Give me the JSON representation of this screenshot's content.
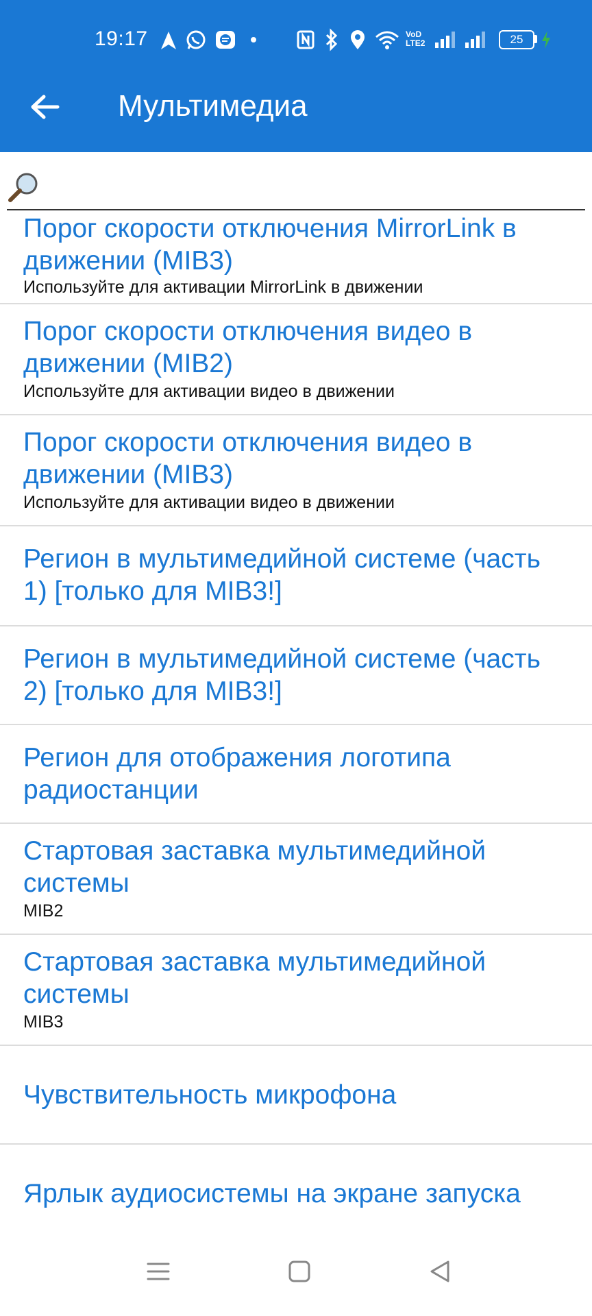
{
  "status_bar": {
    "time": "19:17",
    "battery": "25",
    "network_label_top": "VoD",
    "network_label_bottom": "LTE2"
  },
  "app_bar": {
    "title": "Мультимедиа",
    "background_color": "#1a78d4"
  },
  "search": {
    "value": "",
    "placeholder": ""
  },
  "list": {
    "items": [
      {
        "title": "Порог скорости отключения MirrorLink в движении (MIB3)",
        "subtitle": "Используйте для активации MirrorLink в движении"
      },
      {
        "title": "Порог скорости отключения видео в движении (MIB2)",
        "subtitle": "Используйте для активации видео в движении"
      },
      {
        "title": "Порог скорости отключения видео в движении (MIB3)",
        "subtitle": "Используйте для активации видео в движении"
      },
      {
        "title": "Регион в мультимедийной системе (часть 1) [только для MIB3!]",
        "subtitle": ""
      },
      {
        "title": "Регион в мультимедийной системе (часть 2) [только для MIB3!]",
        "subtitle": ""
      },
      {
        "title": "Регион для отображения логотипа радиостанции",
        "subtitle": ""
      },
      {
        "title": "Стартовая заставка мультимедийной системы",
        "subtitle": "MIB2"
      },
      {
        "title": "Стартовая заставка мультимедийной системы",
        "subtitle": "MIB3"
      },
      {
        "title": "Чувствительность микрофона",
        "subtitle": ""
      },
      {
        "title": "Ярлык аудиосистемы на экране запуска",
        "subtitle": ""
      }
    ],
    "title_color": "#1a78d4"
  },
  "nav_bar": {
    "icons": [
      "menu-icon",
      "home-icon",
      "back-icon"
    ]
  }
}
